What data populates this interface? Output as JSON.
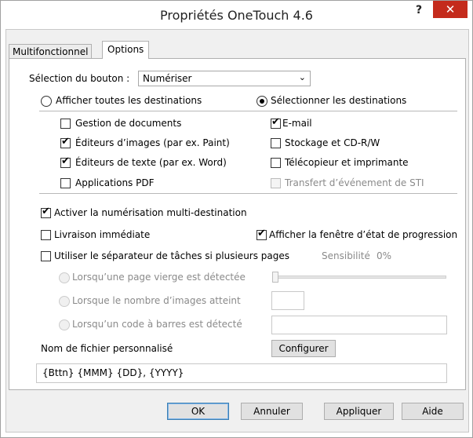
{
  "window": {
    "title": "Propriétés OneTouch 4.6",
    "help_label": "?",
    "close_label": "✕"
  },
  "tabs": [
    {
      "label": "Multifonctionnel",
      "active": false
    },
    {
      "label": "Options",
      "active": true
    }
  ],
  "button_selection": {
    "label": "Sélection du bouton :",
    "value": "Numériser"
  },
  "radios": {
    "show_all": {
      "label": "Afficher toutes les destinations",
      "selected": false
    },
    "select_dest": {
      "label": "Sélectionner les destinations",
      "selected": true
    }
  },
  "destinations": [
    {
      "label": "Gestion de documents",
      "checked": false,
      "enabled": true
    },
    {
      "label": "Éditeurs d’images (par ex. Paint)",
      "checked": true,
      "enabled": true
    },
    {
      "label": "Éditeurs de texte (par ex. Word)",
      "checked": true,
      "enabled": true
    },
    {
      "label": "Applications PDF",
      "checked": false,
      "enabled": true
    },
    {
      "label": "E-mail",
      "checked": true,
      "enabled": true
    },
    {
      "label": "Stockage et CD-R/W",
      "checked": false,
      "enabled": true
    },
    {
      "label": "Télécopieur et imprimante",
      "checked": false,
      "enabled": true
    },
    {
      "label": "Transfert d’événement de STI",
      "checked": false,
      "enabled": false
    }
  ],
  "options": {
    "multi_destination": {
      "label": "Activer la numérisation multi-destination",
      "checked": true
    },
    "immediate_delivery": {
      "label": "Livraison immédiate",
      "checked": false
    },
    "show_progress": {
      "label": "Afficher la fenêtre d’état de progression",
      "checked": true
    },
    "job_separator": {
      "label": "Utiliser le séparateur de tâches si plusieurs pages",
      "checked": false
    }
  },
  "sensitivity": {
    "label": "Sensibilité",
    "value": "0%"
  },
  "separator_options": [
    {
      "label": "Lorsqu’une page vierge est détectée"
    },
    {
      "label": "Lorsque le nombre d’images atteint"
    },
    {
      "label": "Lorsqu’un code à barres est détecté"
    }
  ],
  "filename": {
    "label": "Nom de fichier personnalisé",
    "configure_label": "Configurer",
    "value": "{Bttn} {MMM} {DD}, {YYYY}"
  },
  "footer": {
    "ok": "OK",
    "cancel": "Annuler",
    "apply": "Appliquer",
    "help": "Aide"
  },
  "colors": {
    "close_button": "#c42b1c",
    "dialog_background": "#f0f0f0"
  }
}
